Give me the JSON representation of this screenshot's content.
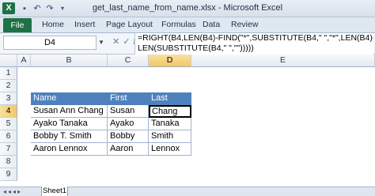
{
  "window": {
    "title": "get_last_name_from_name.xlsx - Microsoft Excel",
    "app_icon": "X"
  },
  "ribbon": {
    "tabs": [
      "File",
      "Home",
      "Insert",
      "Page Layout",
      "Formulas",
      "Data",
      "Review"
    ]
  },
  "formula_bar": {
    "name_box": "D4",
    "formula_line1": "=RIGHT(B4,LEN(B4)-FIND(\"*\",SUBSTITUTE(B4,\" \",\"*\",LEN(B4)-",
    "formula_line2": "LEN(SUBSTITUTE(B4,\" \",\"\")))))"
  },
  "sheet": {
    "columns": [
      "A",
      "B",
      "C",
      "D",
      "E"
    ],
    "rows": [
      "1",
      "2",
      "3",
      "4",
      "5",
      "6",
      "7",
      "8",
      "9"
    ],
    "selected_column": "D",
    "selected_row": "4",
    "table_headers": [
      "Name",
      "First",
      "Last"
    ],
    "table_rows": [
      [
        "Susan Ann Chang",
        "Susan",
        "Chang"
      ],
      [
        "Ayako Tanaka",
        "Ayako",
        "Tanaka"
      ],
      [
        "Bobby T. Smith",
        "Bobby",
        "Smith"
      ],
      [
        "Aaron Lennox",
        "Aaron",
        "Lennox"
      ]
    ],
    "active_cell": "D4"
  },
  "sheet_tabs": [
    "Sheet1"
  ],
  "colors": {
    "header_fill": "#4f81bd",
    "file_tab": "#1e7145"
  }
}
